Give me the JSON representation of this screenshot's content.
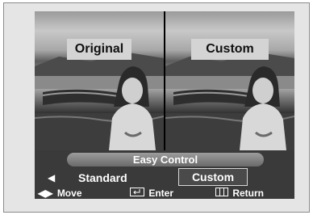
{
  "comparison": {
    "left_label": "Original",
    "right_label": "Custom"
  },
  "osd": {
    "title": "Easy Control",
    "left_arrow": "◀",
    "options": [
      "Standard",
      "Custom"
    ],
    "selected": "Custom",
    "help": {
      "move_icon": "◀▶",
      "move": "Move",
      "enter_icon": "enter-icon",
      "enter": "Enter",
      "return_icon": "menu-icon",
      "return": "Return"
    }
  },
  "colors": {
    "osd_bg": "#3a3a3a",
    "label_bg": "#d4d4d4",
    "frame_bg": "#e5e5e5"
  }
}
